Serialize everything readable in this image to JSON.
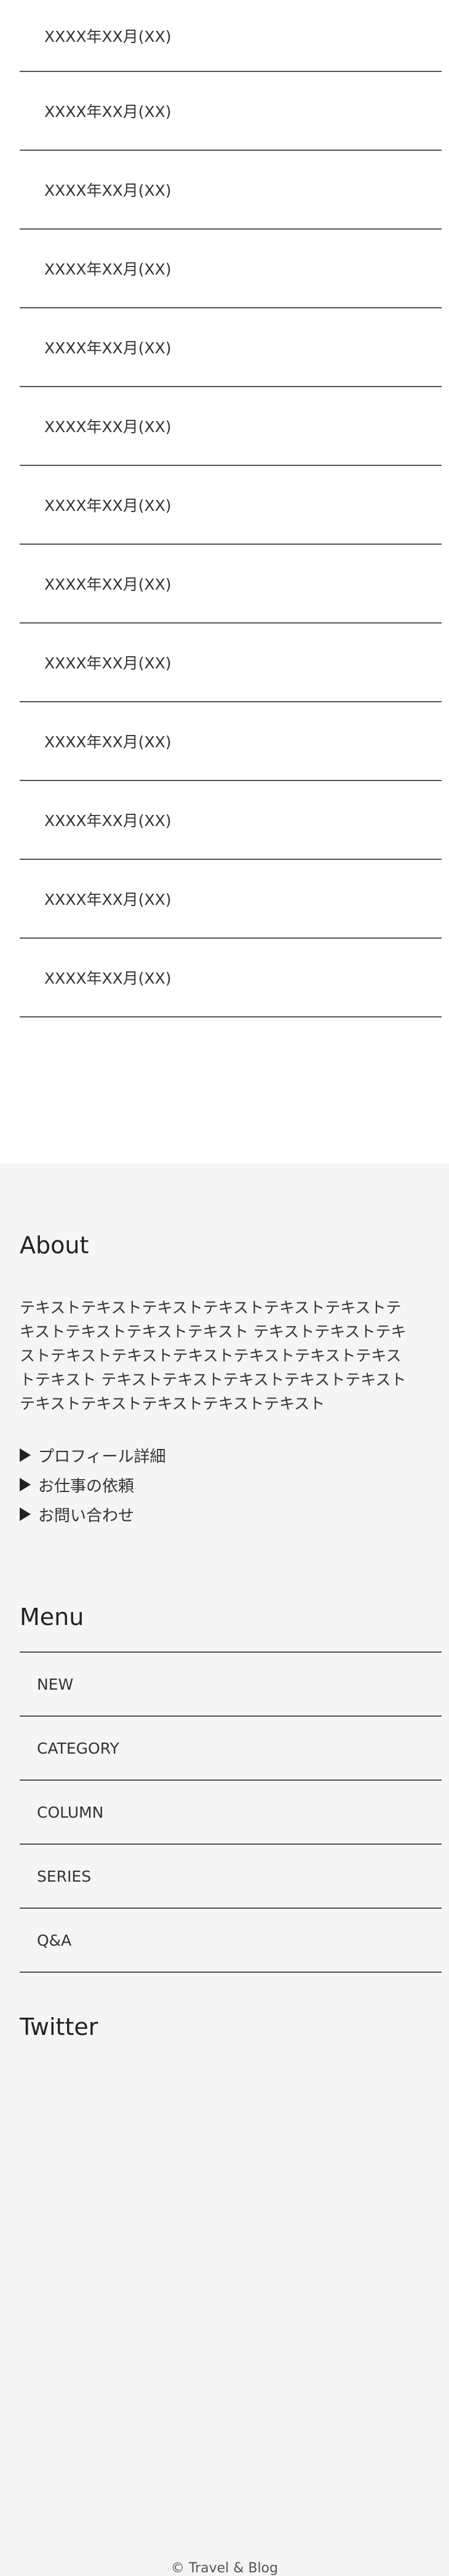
{
  "archive": {
    "items": [
      "XXXX年XX月(XX)",
      "XXXX年XX月(XX)",
      "XXXX年XX月(XX)",
      "XXXX年XX月(XX)",
      "XXXX年XX月(XX)",
      "XXXX年XX月(XX)",
      "XXXX年XX月(XX)",
      "XXXX年XX月(XX)",
      "XXXX年XX月(XX)",
      "XXXX年XX月(XX)",
      "XXXX年XX月(XX)",
      "XXXX年XX月(XX)",
      "XXXX年XX月(XX)"
    ]
  },
  "about": {
    "title": "About",
    "text": "テキストテキストテキストテキストテキストテキストテキストテキストテキストテキスト テキストテキストテキストテキストテキストテキストテキストテキストテキストテキスト テキストテキストテキストテキストテキストテキストテキストテキストテキストテキスト",
    "links": [
      "プロフィール詳細",
      "お仕事の依頼",
      "お問い合わせ"
    ]
  },
  "menu": {
    "title": "Menu",
    "items": [
      "NEW",
      "CATEGORY",
      "COLUMN",
      "SERIES",
      "Q&A"
    ]
  },
  "twitter": {
    "title": "Twitter"
  },
  "footer": {
    "copyright": "© Travel & Blog"
  }
}
